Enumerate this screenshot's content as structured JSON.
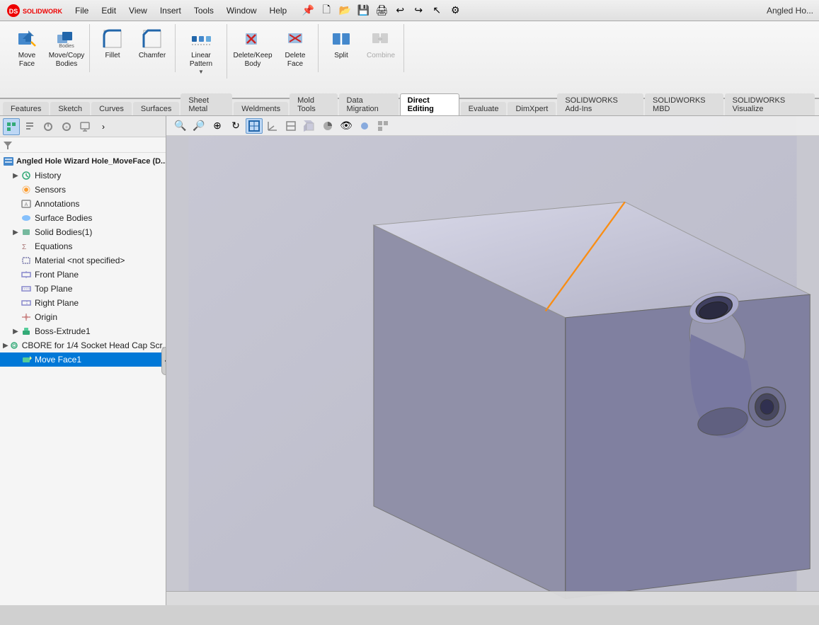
{
  "titlebar": {
    "app_name": "SOLIDWORKS",
    "menu_items": [
      "File",
      "Edit",
      "View",
      "Insert",
      "Tools",
      "Window",
      "Help"
    ],
    "title": "Angled Ho..."
  },
  "ribbon": {
    "tools": [
      {
        "id": "move-face",
        "label": "Move\nFace",
        "group": 1,
        "icon": "move"
      },
      {
        "id": "move-copy-bodies",
        "label": "Move/Copy\nBodies",
        "group": 1,
        "icon": "move-copy"
      },
      {
        "id": "fillet",
        "label": "Fillet",
        "group": 2,
        "icon": "fillet"
      },
      {
        "id": "chamfer",
        "label": "Chamfer",
        "group": 2,
        "icon": "chamfer"
      },
      {
        "id": "linear-pattern",
        "label": "Linear\nPattern",
        "group": 3,
        "icon": "linear",
        "dropdown": true
      },
      {
        "id": "delete-keep-body",
        "label": "Delete/Keep\nBody",
        "group": 4,
        "icon": "delete"
      },
      {
        "id": "delete-face",
        "label": "Delete\nFace",
        "group": 4,
        "icon": "delete-face"
      },
      {
        "id": "split",
        "label": "Split",
        "group": 5,
        "icon": "split"
      },
      {
        "id": "combine",
        "label": "Combine",
        "group": 5,
        "icon": "combine",
        "disabled": true
      }
    ]
  },
  "tabs": [
    {
      "id": "features",
      "label": "Features"
    },
    {
      "id": "sketch",
      "label": "Sketch"
    },
    {
      "id": "curves",
      "label": "Curves"
    },
    {
      "id": "surfaces",
      "label": "Surfaces"
    },
    {
      "id": "sheet-metal",
      "label": "Sheet Metal"
    },
    {
      "id": "weldments",
      "label": "Weldments"
    },
    {
      "id": "mold-tools",
      "label": "Mold Tools"
    },
    {
      "id": "data-migration",
      "label": "Data Migration"
    },
    {
      "id": "direct-editing",
      "label": "Direct Editing",
      "active": true
    },
    {
      "id": "evaluate",
      "label": "Evaluate"
    },
    {
      "id": "dimxpert",
      "label": "DimXpert"
    },
    {
      "id": "sw-addins",
      "label": "SOLIDWORKS Add-Ins"
    },
    {
      "id": "sw-mbd",
      "label": "SOLIDWORKS MBD"
    },
    {
      "id": "sw-visualize",
      "label": "SOLIDWORKS Visualize"
    }
  ],
  "feature_tree": {
    "document_name": "Angled Hole Wizard Hole_MoveFace (D...",
    "items": [
      {
        "id": "history",
        "label": "History",
        "icon": "history",
        "indent": 1,
        "expand": "▶"
      },
      {
        "id": "sensors",
        "label": "Sensors",
        "icon": "sensor",
        "indent": 1,
        "expand": ""
      },
      {
        "id": "annotations",
        "label": "Annotations",
        "icon": "annotations",
        "indent": 1,
        "expand": ""
      },
      {
        "id": "surface-bodies",
        "label": "Surface Bodies",
        "icon": "surface",
        "indent": 1,
        "expand": ""
      },
      {
        "id": "solid-bodies",
        "label": "Solid Bodies(1)",
        "icon": "solid",
        "indent": 1,
        "expand": "▶"
      },
      {
        "id": "equations",
        "label": "Equations",
        "icon": "equations",
        "indent": 1,
        "expand": ""
      },
      {
        "id": "material",
        "label": "Material <not specified>",
        "icon": "material",
        "indent": 1,
        "expand": ""
      },
      {
        "id": "front-plane",
        "label": "Front Plane",
        "icon": "plane",
        "indent": 1,
        "expand": ""
      },
      {
        "id": "top-plane",
        "label": "Top Plane",
        "icon": "plane",
        "indent": 1,
        "expand": ""
      },
      {
        "id": "right-plane",
        "label": "Right Plane",
        "icon": "plane",
        "indent": 1,
        "expand": ""
      },
      {
        "id": "origin",
        "label": "Origin",
        "icon": "origin",
        "indent": 1,
        "expand": ""
      },
      {
        "id": "boss-extrude1",
        "label": "Boss-Extrude1",
        "icon": "extrude",
        "indent": 1,
        "expand": "▶"
      },
      {
        "id": "cbore",
        "label": "CBORE for 1/4 Socket Head Cap Scr...",
        "icon": "cbore",
        "indent": 1,
        "expand": "▶"
      },
      {
        "id": "move-face1",
        "label": "Move Face1",
        "icon": "move-face",
        "indent": 1,
        "expand": "",
        "selected": true
      }
    ]
  },
  "viewport": {
    "background_color": "#c2c2ce"
  },
  "statusbar": {
    "text": ""
  }
}
